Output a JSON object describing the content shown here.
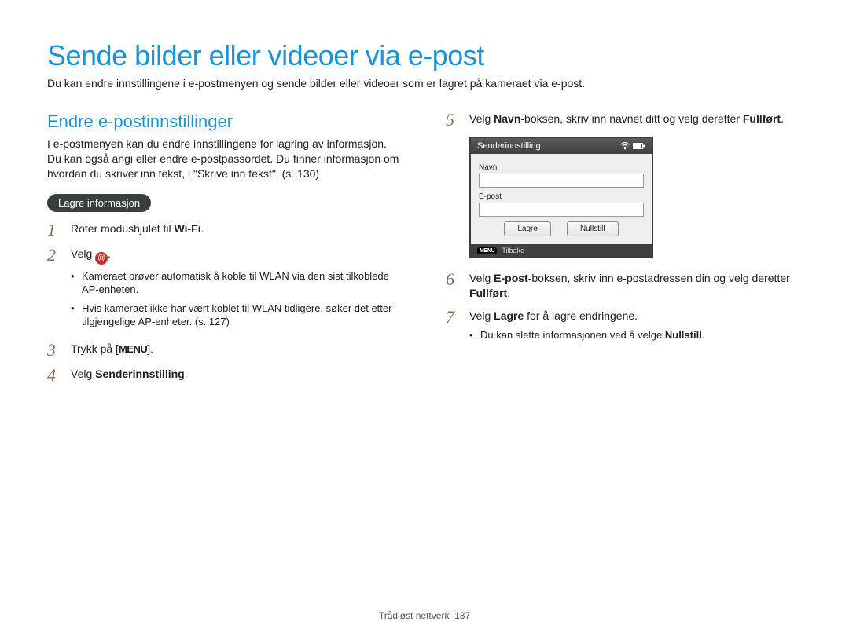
{
  "title": "Sende bilder eller videoer via e-post",
  "intro": "Du kan endre innstillingene i e-postmenyen og sende bilder eller videoer som er lagret på kameraet via e-post.",
  "subtitle": "Endre e-postinnstillinger",
  "subpara": "I e-postmenyen kan du endre innstillingene for lagring av informasjon. Du kan også angi eller endre e-postpassordet. Du finner informasjon om hvordan du skriver inn tekst, i \"Skrive inn tekst\". (s. 130)",
  "pill": "Lagre informasjon",
  "left_steps": {
    "s1_pre": "Roter modushjulet til ",
    "s1_wifi": "Wi-Fi",
    "s1_post": ".",
    "s2_pre": "Velg ",
    "s2_post": ".",
    "s2_sub1": "Kameraet prøver automatisk å koble til WLAN via den sist tilkoblede AP-enheten.",
    "s2_sub2": "Hvis kameraet ikke har vært koblet til WLAN tidligere, søker det etter tilgjengelige AP-enheter. (s. 127)",
    "s3_pre": "Trykk på [",
    "s3_menu": "MENU",
    "s3_post": "].",
    "s4_pre": "Velg ",
    "s4_bold": "Senderinnstilling",
    "s4_post": "."
  },
  "right_steps": {
    "s5_pre": "Velg ",
    "s5_b1": "Navn",
    "s5_mid": "-boksen, skriv inn navnet ditt og velg deretter ",
    "s5_b2": "Fullført",
    "s5_post": ".",
    "s6_pre": "Velg ",
    "s6_b1": "E-post",
    "s6_mid": "-boksen, skriv inn e-postadressen din og velg deretter ",
    "s6_b2": "Fullført",
    "s6_post": ".",
    "s7_pre": "Velg ",
    "s7_b1": "Lagre",
    "s7_post": " for å lagre endringene.",
    "s7_sub1_pre": "Du kan slette informasjonen ved å velge ",
    "s7_sub1_b": "Nullstill",
    "s7_sub1_post": "."
  },
  "dialog": {
    "header": "Senderinnstilling",
    "name_label": "Navn",
    "email_label": "E-post",
    "save_btn": "Lagre",
    "reset_btn": "Nullstill",
    "footer_menu": "MENU",
    "footer_back": "Tilbake"
  },
  "footer": {
    "section": "Trådløst nettverk",
    "page": "137"
  }
}
